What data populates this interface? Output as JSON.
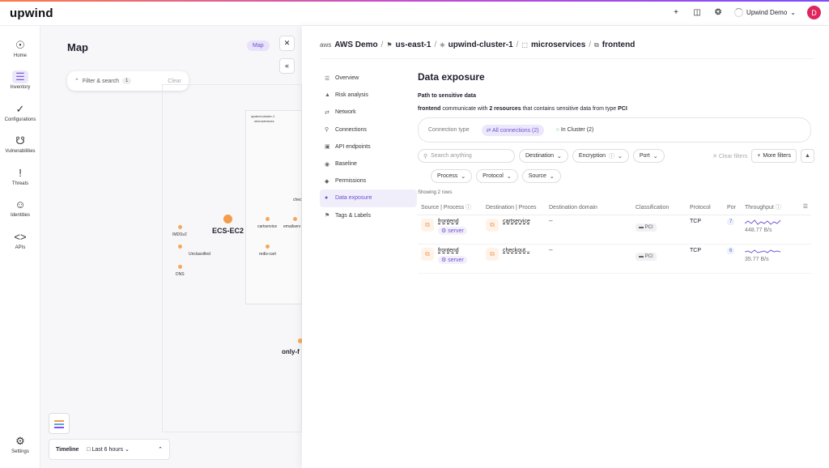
{
  "app": {
    "logo": "upwind",
    "user_name": "Upwind Demo",
    "user_initial": "D"
  },
  "sidebar": {
    "items": [
      {
        "label": "Home",
        "icon": "home-icon"
      },
      {
        "label": "Inventory",
        "icon": "inventory-icon"
      },
      {
        "label": "Configurations",
        "icon": "check-icon"
      },
      {
        "label": "Vulnerabilities",
        "icon": "bug-icon"
      },
      {
        "label": "Threats",
        "icon": "alert-icon"
      },
      {
        "label": "Identities",
        "icon": "person-icon"
      },
      {
        "label": "APIs",
        "icon": "code-icon"
      },
      {
        "label": "Settings",
        "icon": "sliders-icon"
      }
    ]
  },
  "map": {
    "title": "Map",
    "map_button": "Map",
    "filter_label": "Filter & search",
    "filter_count": "1",
    "filter_clear": "Clear",
    "cluster_title": "upwind-cluster-1",
    "cluster_sub": "microservices",
    "ec2_label": "ECS-EC2",
    "only_label": "only-f",
    "nodes": [
      "IMDSv2",
      "Unclassified",
      "DNS",
      "cartservice",
      "emailserv",
      "redis-cart",
      "chec"
    ],
    "timeline_label": "Timeline",
    "timeline_range": "Last 6 hours"
  },
  "breadcrumb": {
    "account": "AWS Demo",
    "region": "us-east-1",
    "cluster": "upwind-cluster-1",
    "namespace": "microservices",
    "workload": "frontend"
  },
  "subnav": {
    "items": [
      "Overview",
      "Risk analysis",
      "Network",
      "Connections",
      "API endpoints",
      "Baseline",
      "Permissions",
      "Data exposure",
      "Tags & Labels"
    ]
  },
  "content": {
    "title": "Data exposure",
    "path_heading": "Path to sensitive data",
    "desc_subject": "frontend",
    "desc_middle": "communicate with",
    "desc_count": "2 resources",
    "desc_tail": "that contains sensitive data from type",
    "desc_type": "PCI",
    "connection_type_label": "Connection type",
    "all_connections": "All connections (2)",
    "in_cluster": "In Cluster (2)",
    "search_placeholder": "Search anything",
    "filters": [
      "Destination",
      "Encryption",
      "Port",
      "Process",
      "Protocol",
      "Source"
    ],
    "clear_filters": "Clear filters",
    "more_filters": "More filters",
    "showing": "Showing 2 rows",
    "columns": [
      "Source | Process",
      "Destination | Proces",
      "Destination domain",
      "Classification",
      "Protocol",
      "Por",
      "Throughput"
    ],
    "rows": [
      {
        "source": "frontend",
        "process": "server",
        "destination": "cartservice",
        "domain": "--",
        "classification": "PCI",
        "protocol": "TCP",
        "port": "7",
        "throughput": "448.77 B/s"
      },
      {
        "source": "frontend",
        "process": "server",
        "destination": "checkout...",
        "domain": "--",
        "classification": "PCI",
        "protocol": "TCP",
        "port": "6",
        "throughput": "35.77 B/s"
      }
    ]
  },
  "colors": {
    "accent": "#6d4fd1",
    "accent_bg": "#ece8fb",
    "node_orange": "#f39c4a",
    "avatar": "#e0245e"
  }
}
